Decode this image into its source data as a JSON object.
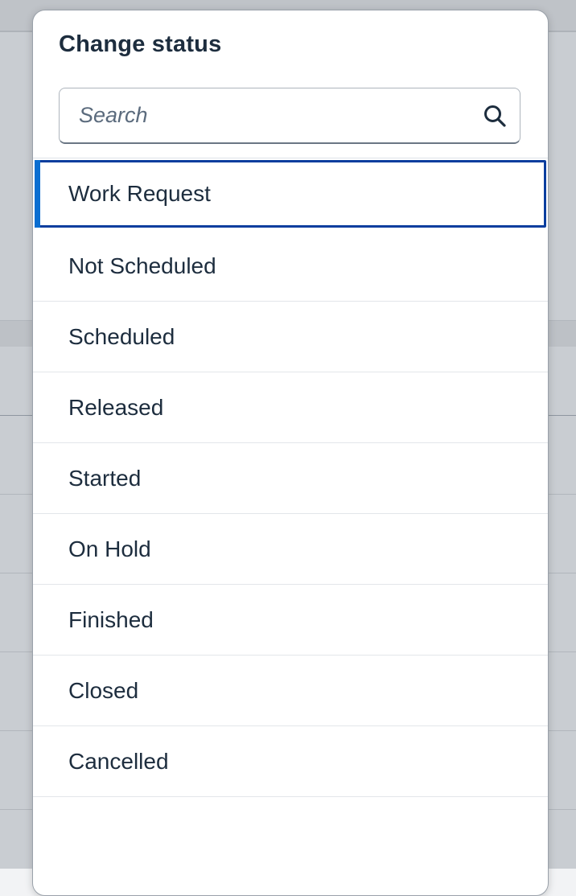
{
  "popover": {
    "title": "Change status",
    "search": {
      "placeholder": "Search",
      "value": "",
      "icon": "search-icon"
    },
    "items": [
      {
        "label": "Work Request",
        "selected": true
      },
      {
        "label": "Not Scheduled",
        "selected": false
      },
      {
        "label": "Scheduled",
        "selected": false
      },
      {
        "label": "Released",
        "selected": false
      },
      {
        "label": "Started",
        "selected": false
      },
      {
        "label": "On Hold",
        "selected": false
      },
      {
        "label": "Finished",
        "selected": false
      },
      {
        "label": "Closed",
        "selected": false
      },
      {
        "label": "Cancelled",
        "selected": false
      }
    ]
  },
  "colors": {
    "text": "#1d2d3e",
    "focus_border": "#0a3d9e",
    "selection_indicator": "#0a6ed1",
    "backdrop": "#c9cdd2"
  }
}
